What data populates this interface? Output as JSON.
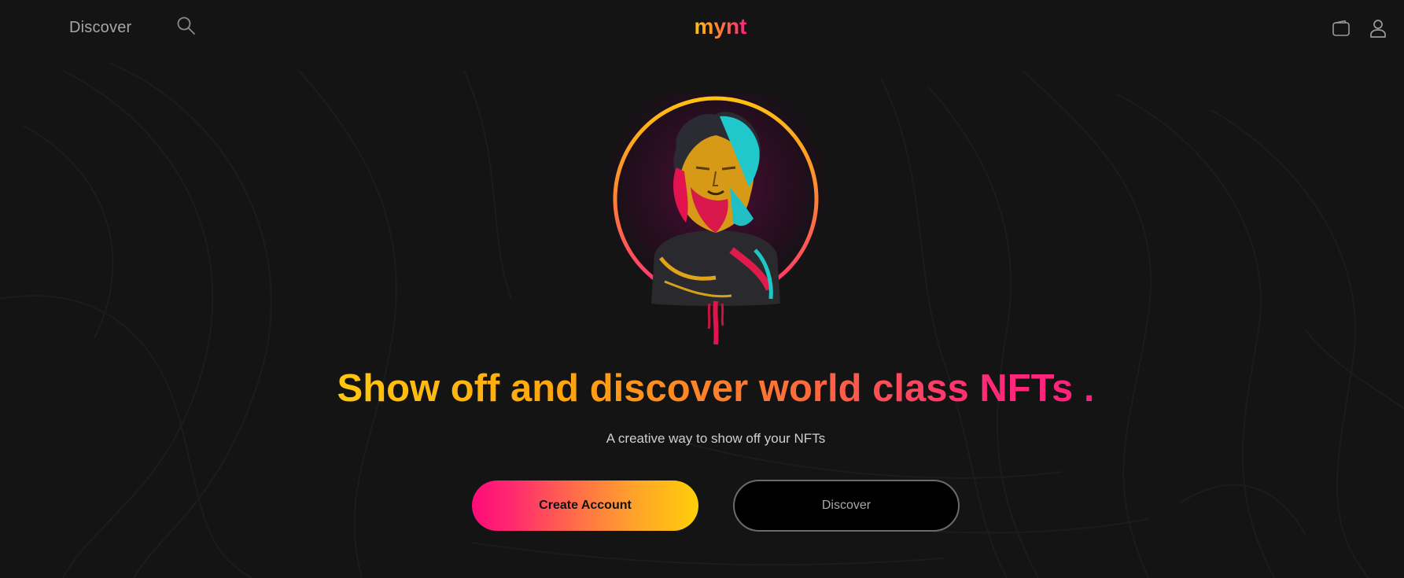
{
  "header": {
    "nav_discover": "Discover",
    "search_icon": "search-icon",
    "logo_text": "mynt",
    "wallet_icon": "wallet-icon",
    "user_icon": "user-icon"
  },
  "hero": {
    "headline": "Show off and discover world class NFTs .",
    "subtitle": "A creative way to show off your NFTs",
    "primary_button": "Create Account",
    "secondary_button": "Discover"
  },
  "colors": {
    "background": "#141414",
    "accent_yellow": "#ffc70f",
    "accent_orange": "#ffa40d",
    "accent_pink": "#ff1f7f",
    "muted_text": "#a6a6a6"
  }
}
